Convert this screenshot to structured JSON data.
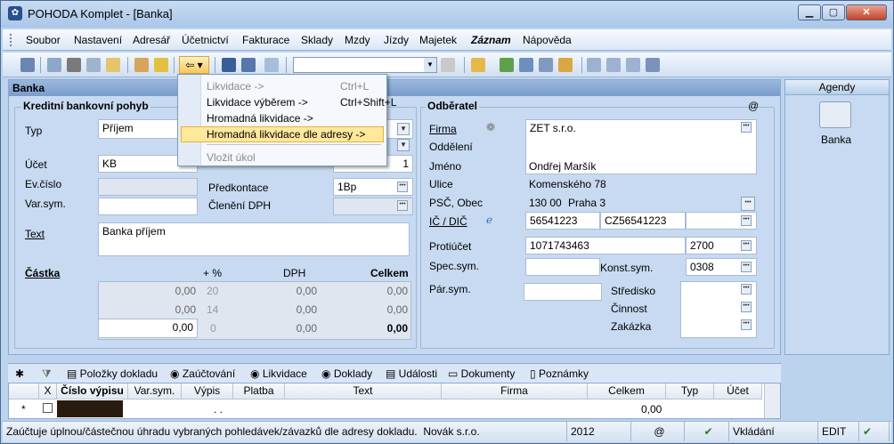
{
  "window": {
    "title": "POHODA Komplet - [Banka]"
  },
  "menu": [
    "Soubor",
    "Nastavení",
    "Adresář",
    "Účetnictví",
    "Fakturace",
    "Sklady",
    "Mzdy",
    "Jízdy",
    "Majetek",
    "Záznam",
    "Nápověda"
  ],
  "panel": {
    "title": "Banka",
    "left_section": "Kreditní bankovní pohyb",
    "right_section": "Odběratel",
    "at": "@"
  },
  "form": {
    "typ_label": "Typ",
    "typ_value": "Příjem",
    "ucet_label": "Účet",
    "ucet_value": "KB",
    "ucet_suffix": "1",
    "evcislo_label": "Ev.číslo",
    "varsym_label": "Var.sym.",
    "predkontace_label": "Předkontace",
    "predkontace_value": "1Bp",
    "cleneni_label": "Členění DPH",
    "text_label": "Text",
    "text_value": "Banka příjem",
    "castka_label": "Částka",
    "pct_label": "+ %",
    "dph_label": "DPH",
    "celkem_label": "Celkem",
    "rows": [
      {
        "base": "0,00",
        "pct": "20",
        "dph": "0,00",
        "celkem": "0,00"
      },
      {
        "base": "0,00",
        "pct": "14",
        "dph": "0,00",
        "celkem": "0,00"
      },
      {
        "base": "0,00",
        "pct": "0",
        "dph": "0,00",
        "celkem": "0,00"
      }
    ]
  },
  "customer": {
    "firma_label": "Firma",
    "firma_value": "ZET s.r.o.",
    "oddeleni_label": "Oddělení",
    "jmeno_label": "Jméno",
    "jmeno_value": "Ondřej Maršík",
    "ulice_label": "Ulice",
    "ulice_value": "Komenského 78",
    "psc_label": "PSČ, Obec",
    "psc_value": "130 00",
    "obec_value": "Praha 3",
    "ic_label": "IČ / DIČ",
    "ic_value": "56541223",
    "dic_value": "CZ56541223",
    "protiucet_label": "Protiúčet",
    "protiucet_value": "1071743463",
    "bank_code": "2700",
    "specsym_label": "Spec.sym.",
    "konstsym_label": "Konst.sym.",
    "konstsym_value": "0308",
    "parsym_label": "Pár.sym.",
    "stredisko_label": "Středisko",
    "cinnost_label": "Činnost",
    "zakazka_label": "Zakázka"
  },
  "dropdown": {
    "items": [
      {
        "label": "Likvidace ->",
        "shortcut": "Ctrl+L",
        "disabled": true
      },
      {
        "label": "Likvidace výběrem ->",
        "shortcut": "Ctrl+Shift+L",
        "disabled": false
      },
      {
        "label": "Hromadná likvidace ->",
        "shortcut": "",
        "disabled": false
      },
      {
        "label": "Hromadná likvidace dle adresy ->",
        "shortcut": "",
        "disabled": false,
        "selected": true
      },
      {
        "label": "Vložit úkol",
        "shortcut": "",
        "disabled": true
      }
    ]
  },
  "agendy": {
    "title": "Agendy",
    "item": "Banka"
  },
  "tabs": [
    "Položky dokladu",
    "Zaúčtování",
    "Likvidace",
    "Doklady",
    "Události",
    "Dokumenty",
    "Poznámky"
  ],
  "grid": {
    "columns": [
      "X",
      "Číslo výpisu",
      "Var.sym.",
      "Výpis",
      "Platba",
      "Text",
      "Firma",
      "Celkem",
      "Typ",
      "Účet"
    ],
    "row": {
      "marker": "*",
      "vypis": ". .",
      "celkem": "0,00"
    }
  },
  "status": {
    "message": "Zaúčtuje úplnou/částečnou úhradu vybraných pohledávek/závazků dle adresy dokladu.",
    "company": "Novák s.r.o.",
    "year": "2012",
    "at": "@",
    "mode": "Vkládání",
    "edit": "EDIT"
  }
}
